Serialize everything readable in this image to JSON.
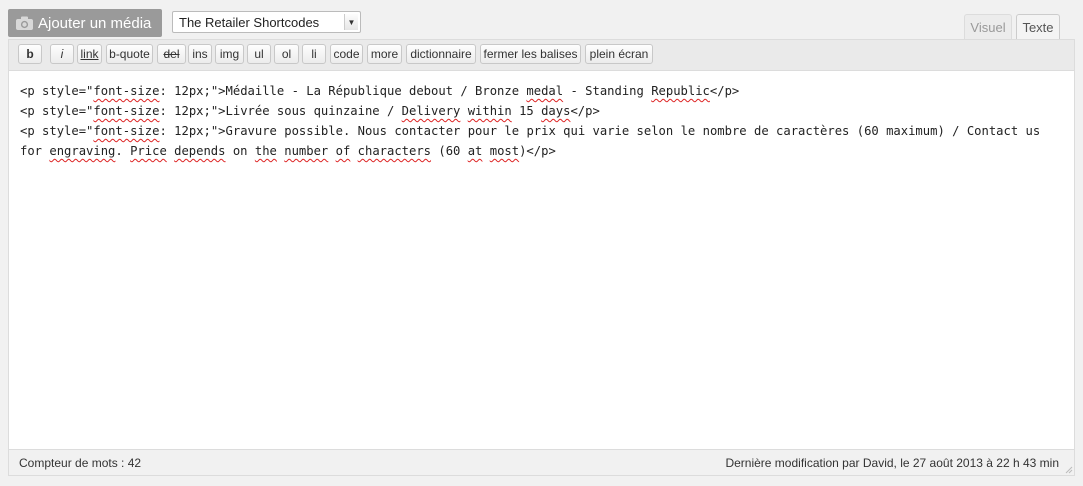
{
  "toolbar": {
    "media_button_label": "Ajouter un média",
    "media_icon": "camera-icon",
    "shortcode_select_value": "The Retailer Shortcodes"
  },
  "tabs": {
    "visual": "Visuel",
    "text": "Texte",
    "active": "text"
  },
  "quicktags": [
    {
      "label": "b",
      "style": "bold"
    },
    {
      "label": "i",
      "style": "ital"
    },
    {
      "label": "link",
      "style": "under"
    },
    {
      "label": "b-quote",
      "style": ""
    },
    {
      "label": "del",
      "style": "strike"
    },
    {
      "label": "ins",
      "style": ""
    },
    {
      "label": "img",
      "style": ""
    },
    {
      "label": "ul",
      "style": ""
    },
    {
      "label": "ol",
      "style": ""
    },
    {
      "label": "li",
      "style": ""
    },
    {
      "label": "code",
      "style": ""
    },
    {
      "label": "more",
      "style": ""
    },
    {
      "label": "dictionnaire",
      "style": ""
    },
    {
      "label": "fermer les balises",
      "style": ""
    },
    {
      "label": "plein écran",
      "style": ""
    }
  ],
  "content": {
    "lines": [
      "<p style=\"font-size: 12px;\">Médaille - La République debout / Bronze medal - Standing Republic</p>",
      "<p style=\"font-size: 12px;\">Livrée sous quinzaine / Delivery within 15 days</p>",
      "<p style=\"font-size: 12px;\">Gravure possible. Nous contacter pour le prix qui varie selon le nombre de caractères (60 maximum) / Contact us for engraving. Price depends on the number of characters (60 at most)</p>"
    ],
    "misspelled": [
      "font-size",
      "medal",
      "Republic",
      "Delivery",
      "within",
      "days",
      "engraving",
      "Price",
      "depends",
      "the",
      "number",
      "of",
      "characters",
      "at",
      "most"
    ]
  },
  "status": {
    "word_count": "Compteur de mots : 42",
    "last_modified": "Dernière modification par David, le 27 août 2013 à 22 h 43 min"
  },
  "colors": {
    "media_button": "#9a9a9a",
    "spellcheck_underline": "#dd2222"
  }
}
